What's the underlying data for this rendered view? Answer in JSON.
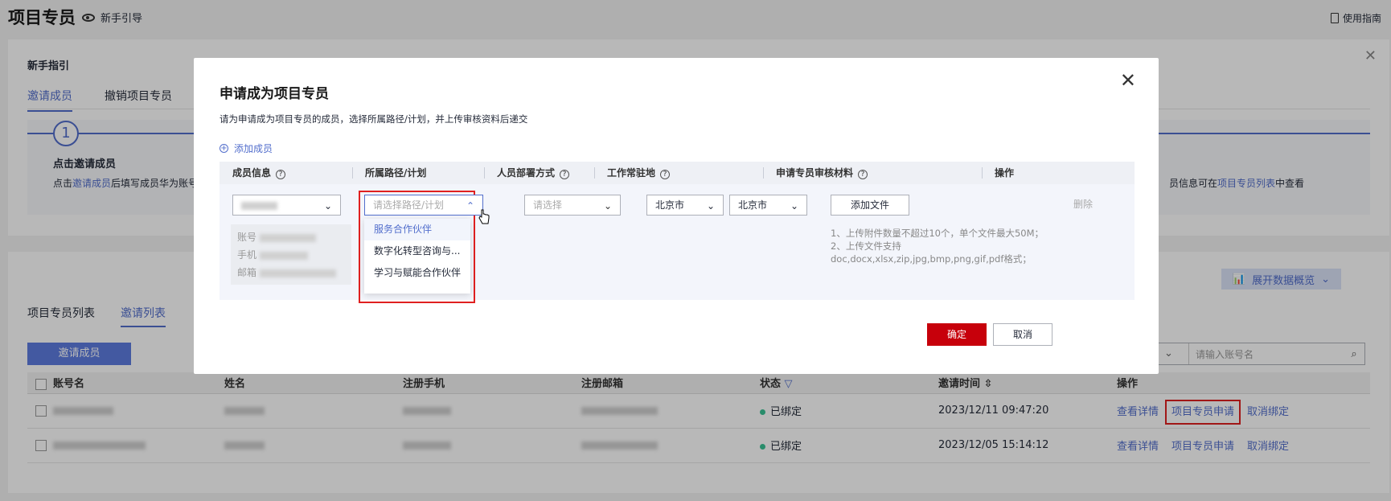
{
  "header": {
    "title": "项目专员",
    "guide_label": "新手引导",
    "use_guide_label": "使用指南"
  },
  "guide_card": {
    "title": "新手指引",
    "tabs": [
      "邀请成员",
      "撤销项目专员"
    ],
    "step_number": "1",
    "step_title": "点击邀请成员",
    "step_desc_prefix": "点击",
    "step_desc_link": "邀请成员",
    "step_desc_suffix": "后填写成员华为账号",
    "step_right_prefix": "员信息可在",
    "step_right_link": "项目专员列表",
    "step_right_suffix": "中查看"
  },
  "list_card": {
    "expand_label": "展开数据概览",
    "tabs": [
      "项目专员列表",
      "邀请列表"
    ],
    "invite_button": "邀请成员",
    "search_placeholder": "请输入账号名",
    "columns": [
      "账号名",
      "姓名",
      "注册手机",
      "注册邮箱",
      "状态",
      "邀请时间",
      "操作"
    ],
    "rows": [
      {
        "status": "已绑定",
        "time": "2023/12/11 09:47:20",
        "ops": [
          "查看详情",
          "项目专员申请",
          "取消绑定"
        ]
      },
      {
        "status": "已绑定",
        "time": "2023/12/05 15:14:12",
        "ops": [
          "查看详情",
          "项目专员申请",
          "取消绑定"
        ]
      }
    ]
  },
  "modal": {
    "title": "申请成为项目专员",
    "subtitle": "请为申请成为项目专员的成员，选择所属路径/计划，并上传审核资料后递交",
    "add_member": "添加成员",
    "columns": [
      "成员信息",
      "所属路径/计划",
      "人员部署方式",
      "工作常驻地",
      "申请专员审核材料",
      "操作"
    ],
    "member_labels": [
      "账号",
      "手机",
      "邮箱"
    ],
    "path_placeholder": "请选择路径/计划",
    "deploy_placeholder": "请选择",
    "city1": "北京市",
    "city2": "北京市",
    "add_file": "添加文件",
    "note1": "1、上传附件数量不超过10个，单个文件最大50M；",
    "note2": "2、上传文件支持doc,docx,xlsx,zip,jpg,bmp,png,gif,pdf格式；",
    "delete": "删除",
    "dropdown": [
      "服务合作伙伴",
      "数字化转型咨询与...",
      "学习与赋能合作伙伴"
    ],
    "ok": "确定",
    "cancel": "取消"
  },
  "colors": {
    "accent": "#526ecc",
    "primary_red": "#c7000b",
    "status_green": "#3ac295",
    "highlight_red": "#e02020"
  }
}
